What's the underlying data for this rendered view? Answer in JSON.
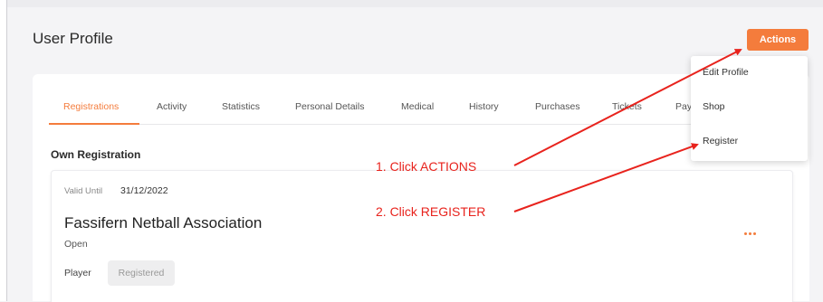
{
  "header": {
    "title": "User Profile",
    "actions_label": "Actions"
  },
  "tabs": [
    {
      "label": "Registrations",
      "active": true
    },
    {
      "label": "Activity",
      "active": false
    },
    {
      "label": "Statistics",
      "active": false
    },
    {
      "label": "Personal Details",
      "active": false
    },
    {
      "label": "Medical",
      "active": false
    },
    {
      "label": "History",
      "active": false
    },
    {
      "label": "Purchases",
      "active": false
    },
    {
      "label": "Tickets",
      "active": false
    },
    {
      "label": "Pay",
      "active": false
    }
  ],
  "section": {
    "title": "Own Registration"
  },
  "registration": {
    "valid_until_label": "Valid Until",
    "valid_until_date": "31/12/2022",
    "organisation": "Fassifern Netball Association",
    "status": "Open",
    "role_label": "Player",
    "role_status": "Registered",
    "more_icon": "ellipsis-icon"
  },
  "dropdown": {
    "items": [
      "Edit Profile",
      "Shop",
      "Register"
    ]
  },
  "annotations": {
    "step1": "1. Click ACTIONS",
    "step2": "2. Click REGISTER"
  },
  "colors": {
    "accent": "#f47c3c",
    "annotation": "#e8231d"
  }
}
